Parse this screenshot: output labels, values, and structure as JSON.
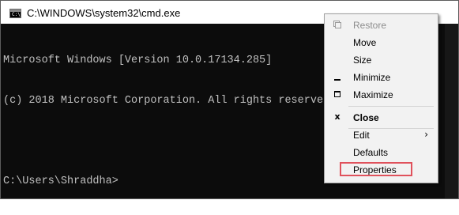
{
  "window": {
    "title": "C:\\WINDOWS\\system32\\cmd.exe",
    "icon": "console-icon"
  },
  "console": {
    "lines": [
      "Microsoft Windows [Version 10.0.17134.285]",
      "(c) 2018 Microsoft Corporation. All rights reserved.",
      "",
      "C:\\Users\\Shraddha>"
    ]
  },
  "context_menu": {
    "items": [
      {
        "label": "Restore",
        "icon": "restore-icon",
        "enabled": false
      },
      {
        "label": "Move",
        "enabled": true
      },
      {
        "label": "Size",
        "enabled": true
      },
      {
        "label": "Minimize",
        "icon": "minimize-icon",
        "enabled": true
      },
      {
        "label": "Maximize",
        "icon": "maximize-icon",
        "enabled": true
      },
      {
        "label": "Close",
        "icon": "close-icon",
        "enabled": true,
        "bold": true
      },
      {
        "label": "Edit",
        "enabled": true,
        "submenu_glyph": "›"
      },
      {
        "label": "Defaults",
        "enabled": true
      },
      {
        "label": "Properties",
        "enabled": true,
        "highlighted": true
      }
    ],
    "close_glyph": "x"
  },
  "colors": {
    "console_background": "#0c0c0c",
    "console_text": "#c0c0c0",
    "menu_background": "#f2f2f2",
    "highlight_border": "#e0525c"
  }
}
